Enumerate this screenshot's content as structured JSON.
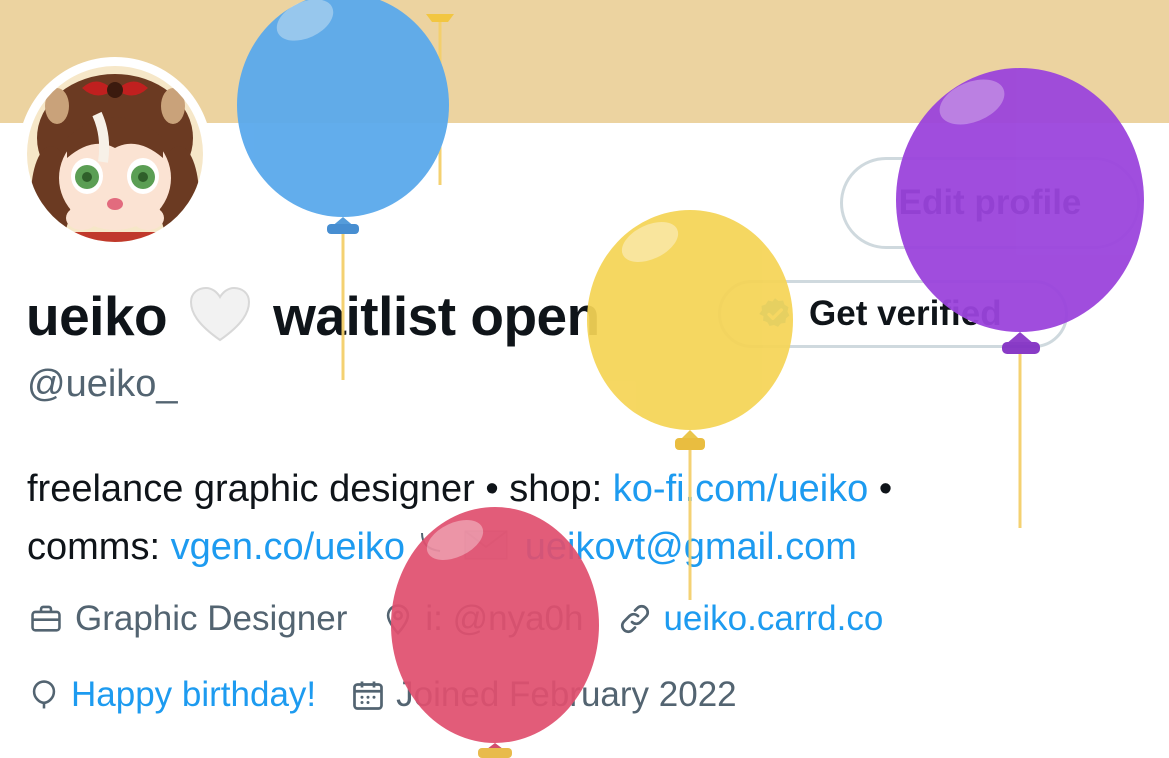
{
  "header": {
    "banner_color": "#ecd3a0"
  },
  "actions": {
    "edit_profile_label": "Edit profile",
    "get_verified_label": "Get verified"
  },
  "profile": {
    "display_name_first": "ueiko",
    "display_name_rest": "waitlist open",
    "heart": "🤍",
    "handle": "@ueiko_"
  },
  "bio": {
    "text1": "freelance graphic designer • shop: ",
    "link1": "ko-fi.com/ueiko",
    "text2": " •",
    "text3": "comms: ",
    "link2": "vgen.co/ueiko",
    "text4": " ",
    "link3": "ueikovt@gmail.com"
  },
  "meta": {
    "profession": "Graphic Designer",
    "location": "i: @nya0h",
    "website": "ueiko.carrd.co",
    "birthday": "Happy birthday!",
    "joined": "Joined February 2022"
  },
  "icons": {
    "profession": "briefcase-icon",
    "location": "location-pin-icon",
    "website": "link-icon",
    "birthday": "balloon-icon",
    "joined": "calendar-icon",
    "verified": "verified-badge-icon"
  },
  "colors": {
    "link": "#1d9bf0",
    "secondary_text": "#536471",
    "border": "#cfd9de",
    "balloon_blue": "#5aa9ec",
    "balloon_yellow": "#f5d456",
    "balloon_purple": "#9b44dc",
    "balloon_red": "#e0506f"
  }
}
